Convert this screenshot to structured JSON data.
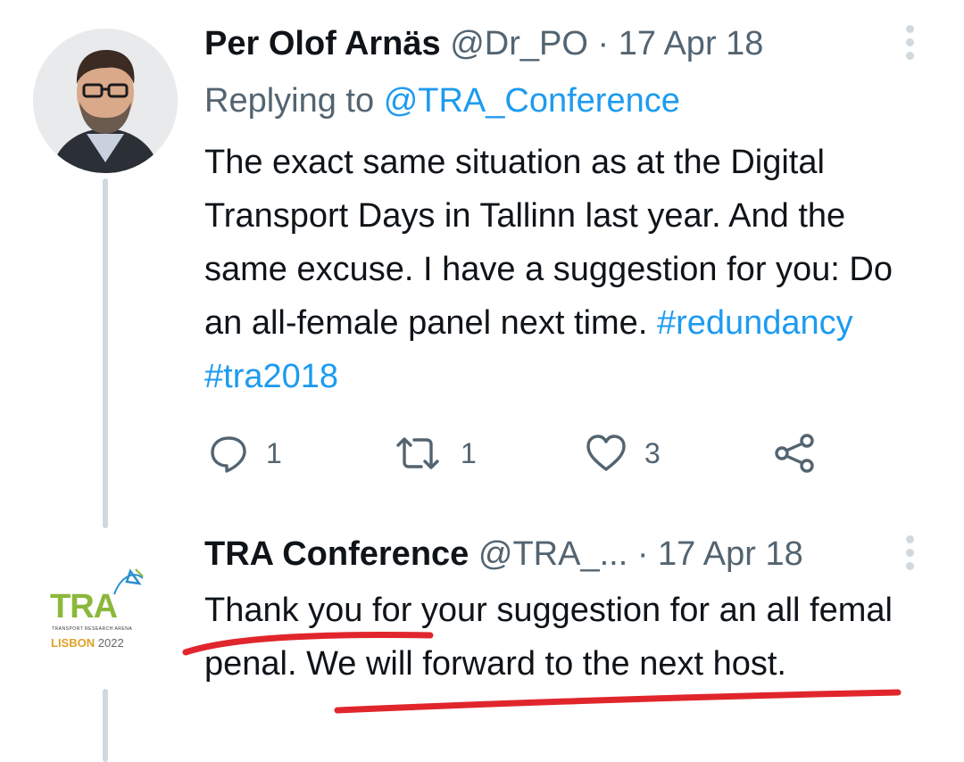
{
  "tweet1": {
    "author_name": "Per Olof Arnäs",
    "handle": "@Dr_PO",
    "separator": "·",
    "date": "17 Apr 18",
    "replying_label": "Replying to",
    "replying_handle": "@TRA_Conference",
    "text": "The exact same situation as at the Digital Transport Days in Tallinn last year. And the same excuse. I have a suggestion for you: Do an all-female panel next time.",
    "hashtags": [
      "#redundancy",
      "#tra2018"
    ],
    "replies": "1",
    "retweets": "1",
    "likes": "3"
  },
  "tweet2": {
    "author_name": "TRA Conference",
    "handle": "@TRA_...",
    "separator": "·",
    "date": "17 Apr 18",
    "text": "Thank you for your suggestion for an all femal penal. We will forward to the next host."
  },
  "logo": {
    "word": "TRA",
    "tagline": "TRANSPORT RESEARCH ARENA",
    "city": "LISBON",
    "year": "2022"
  },
  "colors": {
    "link": "#1d9bf0",
    "muted": "#536471",
    "thread_line": "#cfd9de",
    "annotation": "#e0262c",
    "logo_green": "#8bb83a",
    "logo_blue": "#2a8fd0"
  },
  "icons": [
    "reply-icon",
    "retweet-icon",
    "like-icon",
    "share-icon",
    "more-icon"
  ]
}
